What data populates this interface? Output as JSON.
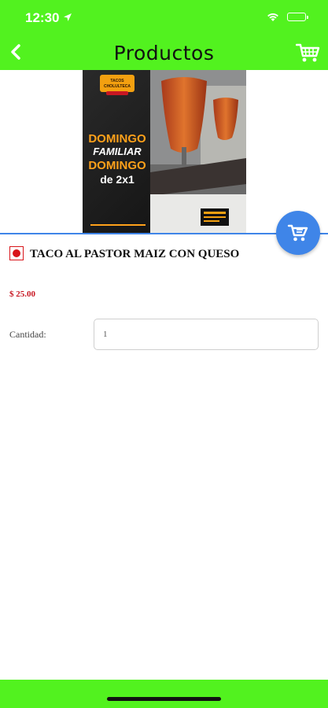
{
  "status": {
    "time": "12:30"
  },
  "header": {
    "title": "Productos"
  },
  "product": {
    "image_alt": "Tacos Cholulteca promo: Domingo Familiar Domingo de 2x1",
    "name": "TACO AL PASTOR MAIZ CON QUESO",
    "price": "$ 25.00"
  },
  "form": {
    "quantity_label": "Cantidad:",
    "quantity_value": "1"
  },
  "promo_lines": [
    "DOMINGO",
    "FAMILIAR",
    "DOMINGO",
    "de 2x1"
  ],
  "logo_text": "TACOS CHOLULTECA",
  "colors": {
    "brand_green": "#52f21f",
    "accent_blue": "#3f85e8",
    "price_red": "#c81722"
  }
}
